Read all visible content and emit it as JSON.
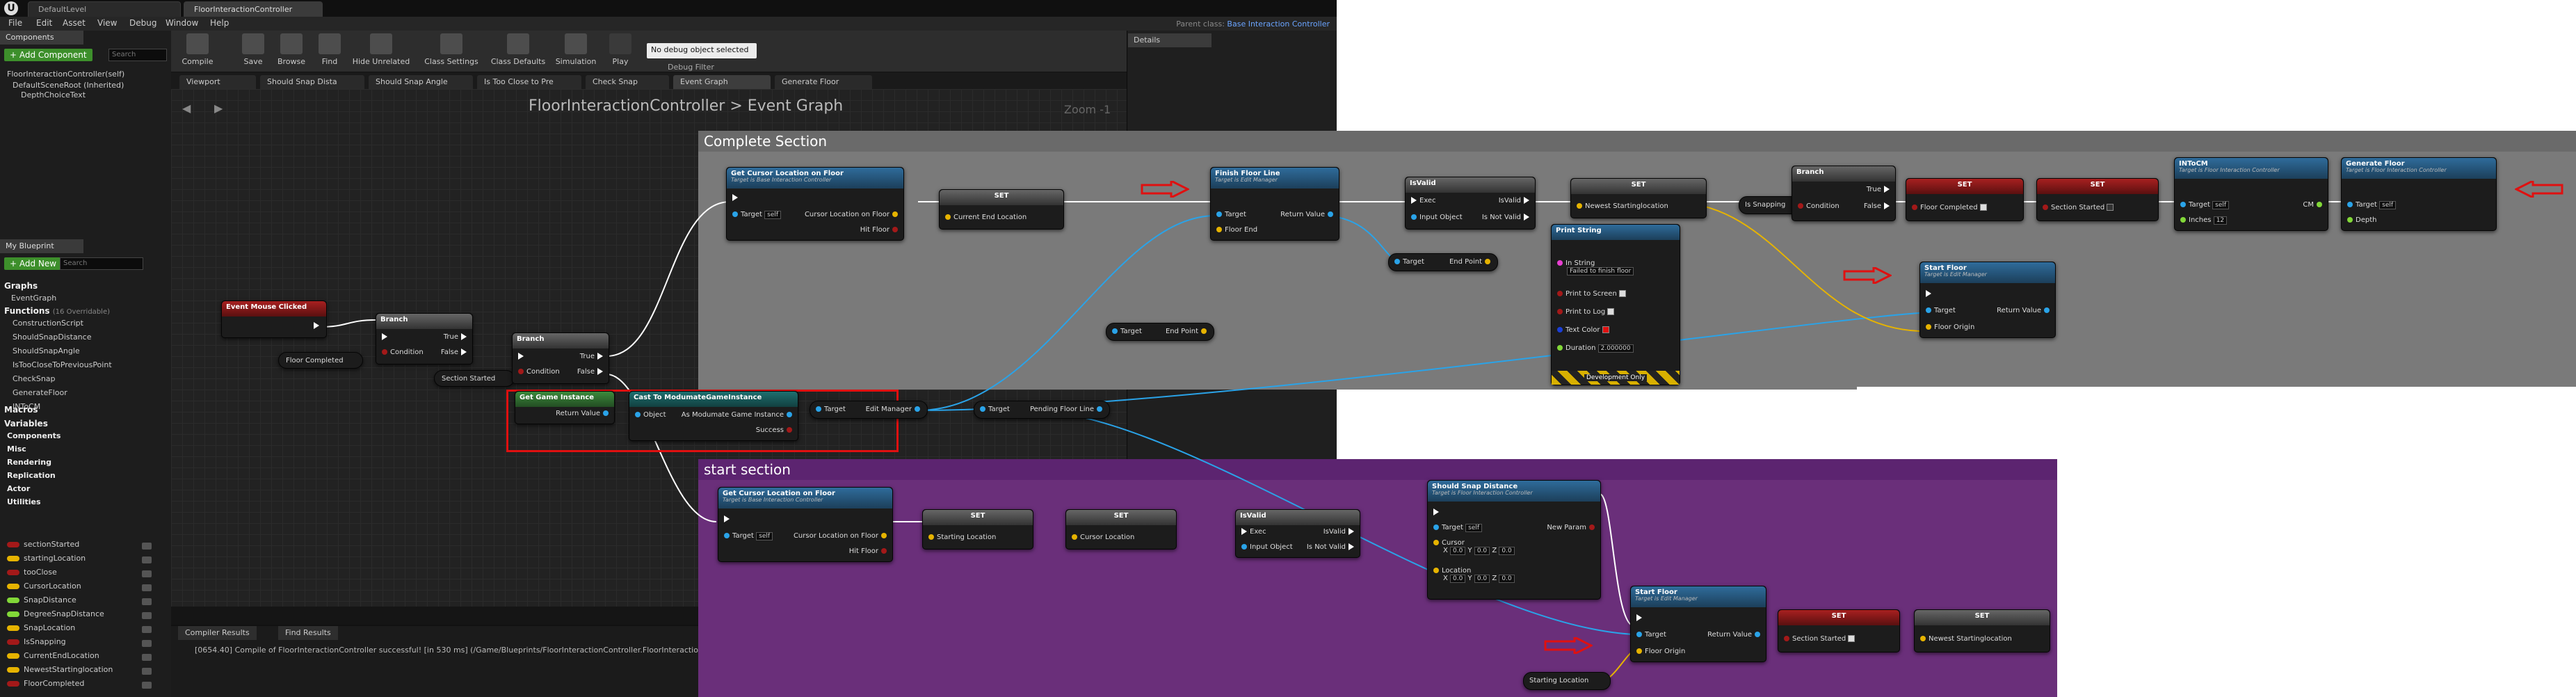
{
  "tabs": {
    "level": "DefaultLevel",
    "controller": "FloorInteractionController"
  },
  "menu": {
    "file": "File",
    "edit": "Edit",
    "asset": "Asset",
    "view": "View",
    "debug": "Debug",
    "window": "Window",
    "help": "Help"
  },
  "parent_class": {
    "label": "Parent class:",
    "value": "Base Interaction Controller"
  },
  "toolbar": {
    "compile": "Compile",
    "save": "Save",
    "browse": "Browse",
    "find": "Find",
    "hide_unrelated": "Hide Unrelated",
    "class_settings": "Class Settings",
    "class_defaults": "Class Defaults",
    "simulation": "Simulation",
    "play": "Play",
    "debug_select": "No debug object selected",
    "debug_filter": "Debug Filter"
  },
  "details": {
    "title": "Details"
  },
  "components": {
    "tab": "Components",
    "add_button": "+ Add Component",
    "search_placeholder": "Search",
    "self_item": "FloorInteractionController(self)",
    "root": "DefaultSceneRoot (Inherited)",
    "child": "DepthChoiceText"
  },
  "mybp": {
    "tab": "My Blueprint",
    "add_button": "+ Add New",
    "search_placeholder": "Search",
    "graphs": "Graphs",
    "event_graph": "EventGraph",
    "functions": "Functions",
    "functions_count": "(16 Overridable)",
    "function_items": [
      "ConstructionScript",
      "ShouldSnapDistance",
      "ShouldSnapAngle",
      "IsTooCloseToPreviousPoint",
      "CheckSnap",
      "GenerateFloor",
      "INToCM"
    ],
    "macros": "Macros",
    "variables": "Variables",
    "var_categories": [
      "Components",
      "Misc",
      "Rendering",
      "Replication",
      "Actor",
      "Utilities"
    ],
    "variable_items": [
      {
        "name": "sectionStarted",
        "color": "#a31919"
      },
      {
        "name": "startingLocation",
        "color": "#e6b300"
      },
      {
        "name": "tooClose",
        "color": "#a31919"
      },
      {
        "name": "CursorLocation",
        "color": "#e6b300"
      },
      {
        "name": "SnapDistance",
        "color": "#82d838"
      },
      {
        "name": "DegreeSnapDistance",
        "color": "#82d838"
      },
      {
        "name": "SnapLocation",
        "color": "#e6b300"
      },
      {
        "name": "IsSnapping",
        "color": "#a31919"
      },
      {
        "name": "CurrentEndLocation",
        "color": "#e6b300"
      },
      {
        "name": "NewestStartinglocation",
        "color": "#e6b300"
      },
      {
        "name": "FloorCompleted",
        "color": "#a31919"
      }
    ]
  },
  "graph_tabs": [
    "Viewport",
    "Should Snap Dista",
    "Should Snap Angle",
    "Is Too Close to Pre",
    "Check Snap",
    "Event Graph",
    "Generate Floor"
  ],
  "graph": {
    "breadcrumb_class": "FloorInteractionController",
    "breadcrumb_sep": ">",
    "breadcrumb_graph": "Event Graph",
    "zoom": "Zoom -1"
  },
  "comments": {
    "complete": "Complete Section",
    "start": "start section"
  },
  "nodes": {
    "event_mouse": "Event Mouse Clicked",
    "floor_completed": "Floor Completed",
    "section_started": "Section Started",
    "branch": "Branch",
    "true": "True",
    "false": "False",
    "condition": "Condition",
    "get_game_instance": "Get Game Instance",
    "return_value": "Return Value",
    "cast": "Cast To ModumateGameInstance",
    "object": "Object",
    "as_modumate": "As Modumate Game Instance",
    "success": "Success",
    "target": "Target",
    "edit_manager": "Edit Manager",
    "pending_floor_line": "Pending Floor Line",
    "get_cursor": "Get Cursor Location on Floor",
    "target_is_base": "Target is Base Interaction Controller",
    "self": "self",
    "cursor_loc_floor": "Cursor Location on Floor",
    "hit_floor": "Hit Floor",
    "set": "SET",
    "current_end_location": "Current End Location",
    "finish_floor_line": "Finish Floor Line",
    "target_is_edit": "Target is Edit Manager",
    "floor_end": "Floor End",
    "end_point": "End Point",
    "is_valid": "IsValid",
    "exec": "Exec",
    "input_object": "Input Object",
    "is_not_valid": "Is Not Valid",
    "newest_starting": "Newest Startinglocation",
    "is_snapping": "Is Snapping",
    "print_string": "Print String",
    "in_string": "In String",
    "failed_msg": "Failed to finish floor",
    "print_screen": "Print to Screen",
    "print_log": "Print to Log",
    "text_color": "Text Color",
    "duration": "Duration",
    "duration_val": "2.000000",
    "dev_only": "Development Only",
    "floor_completed_pin": "Floor Completed",
    "section_started_pin": "Section Started",
    "start_floor": "Start Floor",
    "floor_origin": "Floor Origin",
    "into_cm": "INToCM",
    "target_is_floor": "Target is Floor Interaction Controller",
    "inches": "Inches",
    "inches_val": "12",
    "cm": "CM",
    "generate_floor": "Generate Floor",
    "depth": "Depth",
    "starting_location": "Starting Location",
    "cursor_location": "Cursor Location",
    "should_snap": "Should Snap Distance",
    "new_param": "New Param",
    "cursor": "Cursor",
    "location": "Location",
    "zero": "0.0"
  },
  "bottom": {
    "compiler_tab": "Compiler Results",
    "find_tab": "Find Results",
    "log": "[0654.40] Compile of FloorInteractionController successful! [in 530 ms] (/Game/Blueprints/FloorInteractionController.FloorInteractionCon"
  },
  "colors": {
    "accent_red": "#e01010",
    "exec_pin": "#ffffff",
    "object_pin": "#2aa3e8",
    "vector_pin": "#e6b300",
    "bool_pin": "#a31919"
  }
}
